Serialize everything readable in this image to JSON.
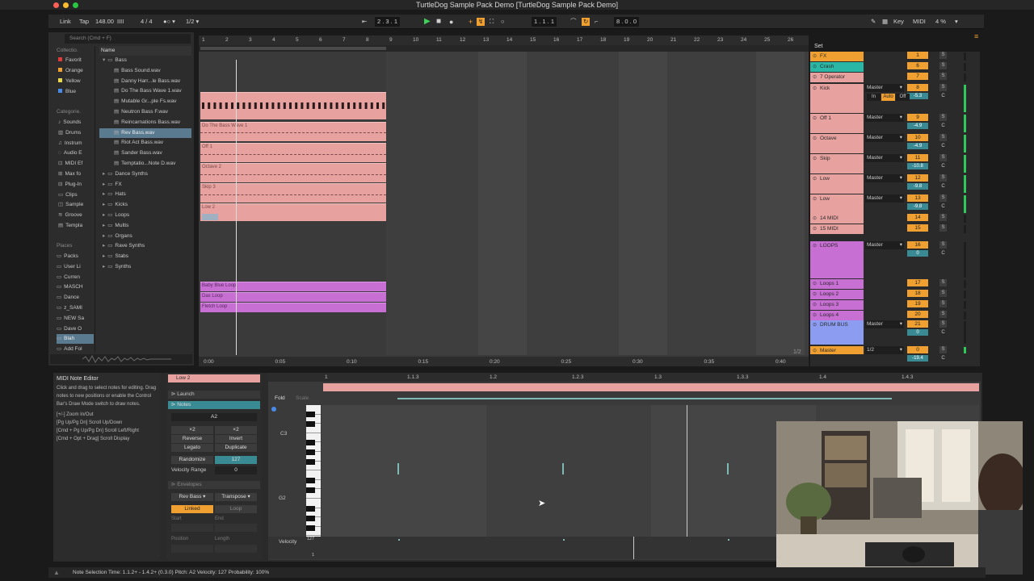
{
  "window": {
    "title": "TurtleDog Sample Pack Demo  [TurtleDog Sample Pack Demo]"
  },
  "control_bar": {
    "link": "Link",
    "tap": "Tap",
    "tempo": "148.00",
    "meter_icon": "IIII",
    "signature": "4 / 4",
    "metronome": "●○ ▾",
    "quantize": "1/2 ▾",
    "position": "2 .   3 .   1",
    "loop_start": "1 .   1 .   1",
    "loop_length": "8 .   0 .   0",
    "key": "Key",
    "midi": "MIDI",
    "cpu": "4 %"
  },
  "browser": {
    "search_placeholder": "Search (Cmd + F)",
    "collections_header": "Collectio.",
    "collections": [
      "Favorit",
      "Orange",
      "Yellow",
      "Blue"
    ],
    "categories_header": "Categorie.",
    "categories": [
      "Sounds",
      "Drums",
      "Instrum",
      "Audio E",
      "MIDI Ef",
      "Max fo",
      "Plug-In",
      "Clips",
      "Sample",
      "Groove",
      "Templa"
    ],
    "places_header": "Places",
    "places": [
      "Packs",
      "User Li",
      "Curren",
      "MASCH",
      "Dance",
      "z_SAMI",
      "NEW Sa",
      "Dave O",
      "Blah",
      "Add Fol"
    ],
    "name_header": "Name",
    "tree": [
      {
        "label": "Bass",
        "depth": 0,
        "open": true
      },
      {
        "label": "Bass Sound.wav",
        "depth": 1
      },
      {
        "label": "Danny Harr...le Bass.wav",
        "depth": 1
      },
      {
        "label": "Do The Bass Wave 1.wav",
        "depth": 1
      },
      {
        "label": "Mutable Gr...ple Fs.wav",
        "depth": 1
      },
      {
        "label": "Neutron Bass F.wav",
        "depth": 1
      },
      {
        "label": "Reincarnations Bass.wav",
        "depth": 1
      },
      {
        "label": "Rev Bass.wav",
        "depth": 1,
        "selected": true
      },
      {
        "label": "Riot Act Bass.wav",
        "depth": 1
      },
      {
        "label": "Sander Bass.wav",
        "depth": 1
      },
      {
        "label": "Temptatio...Note D.wav",
        "depth": 1
      },
      {
        "label": "Dance Synths",
        "depth": 0
      },
      {
        "label": "FX",
        "depth": 0
      },
      {
        "label": "Hats",
        "depth": 0
      },
      {
        "label": "Kicks",
        "depth": 0
      },
      {
        "label": "Loops",
        "depth": 0
      },
      {
        "label": "Multis",
        "depth": 0
      },
      {
        "label": "Organs",
        "depth": 0
      },
      {
        "label": "Rave Synths",
        "depth": 0
      },
      {
        "label": "Stabs",
        "depth": 0
      },
      {
        "label": "Synths",
        "depth": 0
      }
    ]
  },
  "arrangement": {
    "bar_numbers": [
      "1",
      "2",
      "3",
      "4",
      "5",
      "6",
      "7",
      "8",
      "9",
      "10",
      "11",
      "12",
      "13",
      "14",
      "15",
      "16",
      "17",
      "18",
      "19",
      "20",
      "21",
      "22",
      "23",
      "24",
      "25",
      "26"
    ],
    "time_labels": [
      "0:00",
      "0:05",
      "0:10",
      "0:15",
      "0:20",
      "0:25",
      "0:30",
      "0:35",
      "0:40"
    ],
    "zoom": "1/2",
    "clips_red": [
      "",
      "Do The Bass Wave 1",
      "Off 1",
      "Octave 2",
      "Skip 3",
      "Low 2"
    ],
    "clips_purple": [
      "Baby Blue Loop",
      "Dax Loop",
      "Fletch Loop"
    ]
  },
  "mixer": {
    "set_label": "Set",
    "tracks": [
      {
        "name": "FX",
        "num": "1",
        "color": "#f0a030",
        "route": ""
      },
      {
        "name": "Crash",
        "num": "6",
        "color": "#2ab7a6",
        "route": ""
      },
      {
        "name": "7 Operator",
        "num": "7",
        "color": "#e7a2a0",
        "route": ""
      },
      {
        "name": "Kick",
        "num": "8",
        "color": "#e7a2a0",
        "route": "Master",
        "vol": "-5.3"
      },
      {
        "name": "Off 1",
        "num": "9",
        "color": "#e7a2a0",
        "route": "Master",
        "vol": "-4.9"
      },
      {
        "name": "Octave",
        "num": "10",
        "color": "#e7a2a0",
        "route": "Master",
        "vol": "-4.9"
      },
      {
        "name": "Skip",
        "num": "11",
        "color": "#e7a2a0",
        "route": "Master",
        "vol": "-10.8"
      },
      {
        "name": "Low",
        "num": "12",
        "color": "#e7a2a0",
        "route": "Master",
        "vol": "-9.8"
      },
      {
        "name": "Low",
        "num": "13",
        "color": "#e7a2a0",
        "route": "Master",
        "vol": "-9.8"
      },
      {
        "name": "14 MIDI",
        "num": "14",
        "color": "#e7a2a0",
        "route": ""
      },
      {
        "name": "15 MIDI",
        "num": "15",
        "color": "#e7a2a0",
        "route": ""
      },
      {
        "name": "LOOPS",
        "num": "16",
        "color": "#c86fd4",
        "route": "Master",
        "vol": "0"
      },
      {
        "name": "Loops 1",
        "num": "17",
        "color": "#c86fd4",
        "route": ""
      },
      {
        "name": "Loops 2",
        "num": "18",
        "color": "#c86fd4",
        "route": ""
      },
      {
        "name": "Loops 3",
        "num": "19",
        "color": "#c86fd4",
        "route": ""
      },
      {
        "name": "Loops 4",
        "num": "20",
        "color": "#c86fd4",
        "route": ""
      },
      {
        "name": "DRUM BUS",
        "num": "21",
        "color": "#8c9cf0",
        "route": "Master",
        "vol": "0"
      },
      {
        "name": "Master",
        "num": "0",
        "color": "#f0a030",
        "route": "1/2",
        "vol": "-19.4"
      }
    ],
    "kick_toggles": [
      "In",
      "Auto",
      "Off"
    ],
    "solo": "S",
    "cue": "C"
  },
  "midi_editor": {
    "info_title": "MIDI Note Editor",
    "info_text": "Click and drag to select notes for editing. Drag notes to new positions or enable the Control Bar's Draw Mode switch to draw notes.",
    "shortcuts": [
      "[+/-] Zoom In/Out",
      "[Pg Up/Pg Dn] Scroll Up/Down",
      "[Cmd + Pg Up/Pg Dn] Scroll Left/Right",
      "[Cmd + Opt + Drag] Scroll Display"
    ],
    "clip_name": "Low 2",
    "launch": "Launch",
    "notes": "Notes",
    "note_pitch": "A2",
    "x2a": "×2",
    "x2b": "×2",
    "reverse": "Reverse",
    "invert": "Invert",
    "legato": "Legato",
    "duplicate": "Duplicate",
    "randomize": "Randomize",
    "randomize_val": "127",
    "velocity_range": "Velocity Range",
    "velocity_range_val": "0",
    "envelopes": "Envelopes",
    "env_device": "Rev Bass",
    "env_param": "Transpose",
    "linked": "Linked",
    "loop": "Loop",
    "start": "Start",
    "end": "End",
    "position": "Position",
    "length": "Length",
    "fold": "Fold",
    "scale": "Scale",
    "ruler": [
      "1",
      "1.1.3",
      "1.2",
      "1.2.3",
      "1.3",
      "1.3.3",
      "1.4",
      "1.4.3"
    ],
    "key_c3": "C3",
    "key_g2": "G2",
    "velocity_label": "Velocity",
    "vel_max": "127",
    "vel_min": "1"
  },
  "status": {
    "text": "Note Selection    Time: 1.1.2+ - 1.4.2+ (0.3.0)    Pitch: A2    Velocity: 127    Probability: 100%"
  }
}
